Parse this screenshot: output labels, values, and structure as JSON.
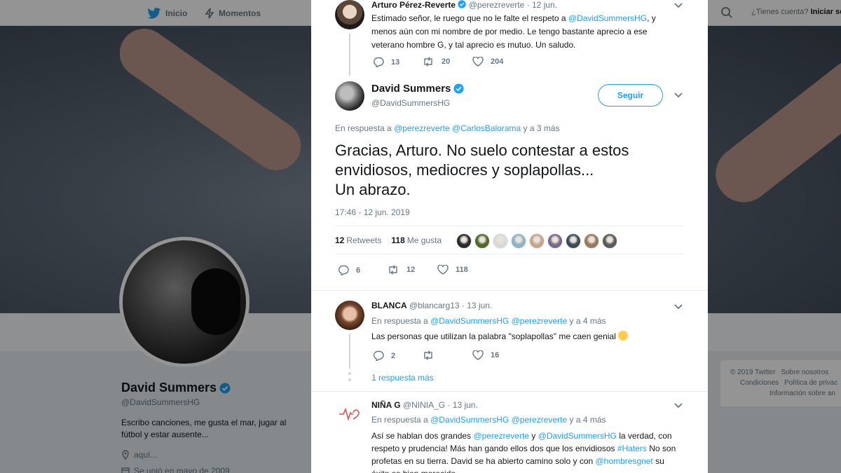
{
  "nav": {
    "home_label": "Inicio",
    "moments_label": "Momentos",
    "account_question": "¿Tienes cuenta?",
    "login_label": "Iniciar ses"
  },
  "profile": {
    "name": "David Summers",
    "handle": "@DavidSummersHG",
    "bio": "Escribo canciones, me gusta el mar, jugar al fútbol y estar ausente...",
    "location": "aquí...",
    "joined": "Se unió en mayo de 2009"
  },
  "footer": {
    "copyright": "© 2019 Twitter",
    "about": "Sobre nosotros",
    "terms": "Condiciones",
    "privacy": "Política de privac",
    "ads": "Información sobre an"
  },
  "parent_tweet": {
    "name": "Arturo Pérez-Reverte",
    "handle": "@perezreverte",
    "date": "· 12 jun.",
    "text_before": "Estimado señor, le ruego que no le falte el respeto a ",
    "mention": "@DavidSummersHG",
    "text_after": ", y menos aún con mi nombre de por medio. Le tengo bastante aprecio a ese veterano hombre G, y tal aprecio es mutuo. Un saludo.",
    "replies": "13",
    "retweets": "20",
    "likes": "204"
  },
  "main_tweet": {
    "name": "David Summers",
    "handle": "@DavidSummersHG",
    "follow_label": "Seguir",
    "replying_prefix": "En respuesta a ",
    "replying_mention1": "@perezreverte",
    "replying_mention2": "@CarlosBalorama",
    "replying_suffix": " y a 3 más",
    "line1": "Gracias, Arturo. No suelo contestar a estos",
    "line2": "envidiosos, mediocres y soplapollas...",
    "line3": "Un abrazo.",
    "timestamp": "17:46 - 12 jun. 2019",
    "retweets_count": "12",
    "retweets_label": "Retweets",
    "likes_count": "118",
    "likes_label": "Me gusta",
    "replies": "6",
    "retweets": "12",
    "likes": "118",
    "liker_colors": [
      "#2b2b2b",
      "#4f6b2a",
      "#d9d9d9",
      "#8fb3c9",
      "#c4a78a",
      "#7a6a8a",
      "#3d4a57",
      "#9a7a5a",
      "#5a5a5a"
    ]
  },
  "reply1": {
    "name": "BLANCA",
    "handle": "@blancarg13",
    "date": "· 13 jun.",
    "replying_prefix": "En respuesta a ",
    "mention1": "@DavidSummersHG",
    "mention2": "@perezreverte",
    "replying_suffix": " y a 4 más",
    "text": "Las personas que utilizan la palabra \"soplapollas\" me caen genial",
    "replies": "2",
    "retweets": "",
    "likes": "16",
    "more_replies": "1 respuesta más"
  },
  "reply2": {
    "name": "NIÑA G",
    "handle": "@NINIA_G",
    "date": "· 13 jun.",
    "replying_prefix": "En respuesta a ",
    "mention1": "@DavidSummersHG",
    "mention2": "@perezreverte",
    "replying_suffix": " y a 4 más",
    "text_a": "Así se hablan dos grandes ",
    "text_m1": "@perezreverte",
    "text_b": " y ",
    "text_m2": "@DavidSummersHG",
    "text_c": " la verdad, con respeto y prudencia! Más han gando ellos dos que los envidiosos ",
    "text_hashtag": "#Haters",
    "text_d": " No son profetas en su tierra. David se ha abierto camino solo y con ",
    "text_m3": "@hombresgnet",
    "text_e": " su éxito es bien merecido."
  }
}
